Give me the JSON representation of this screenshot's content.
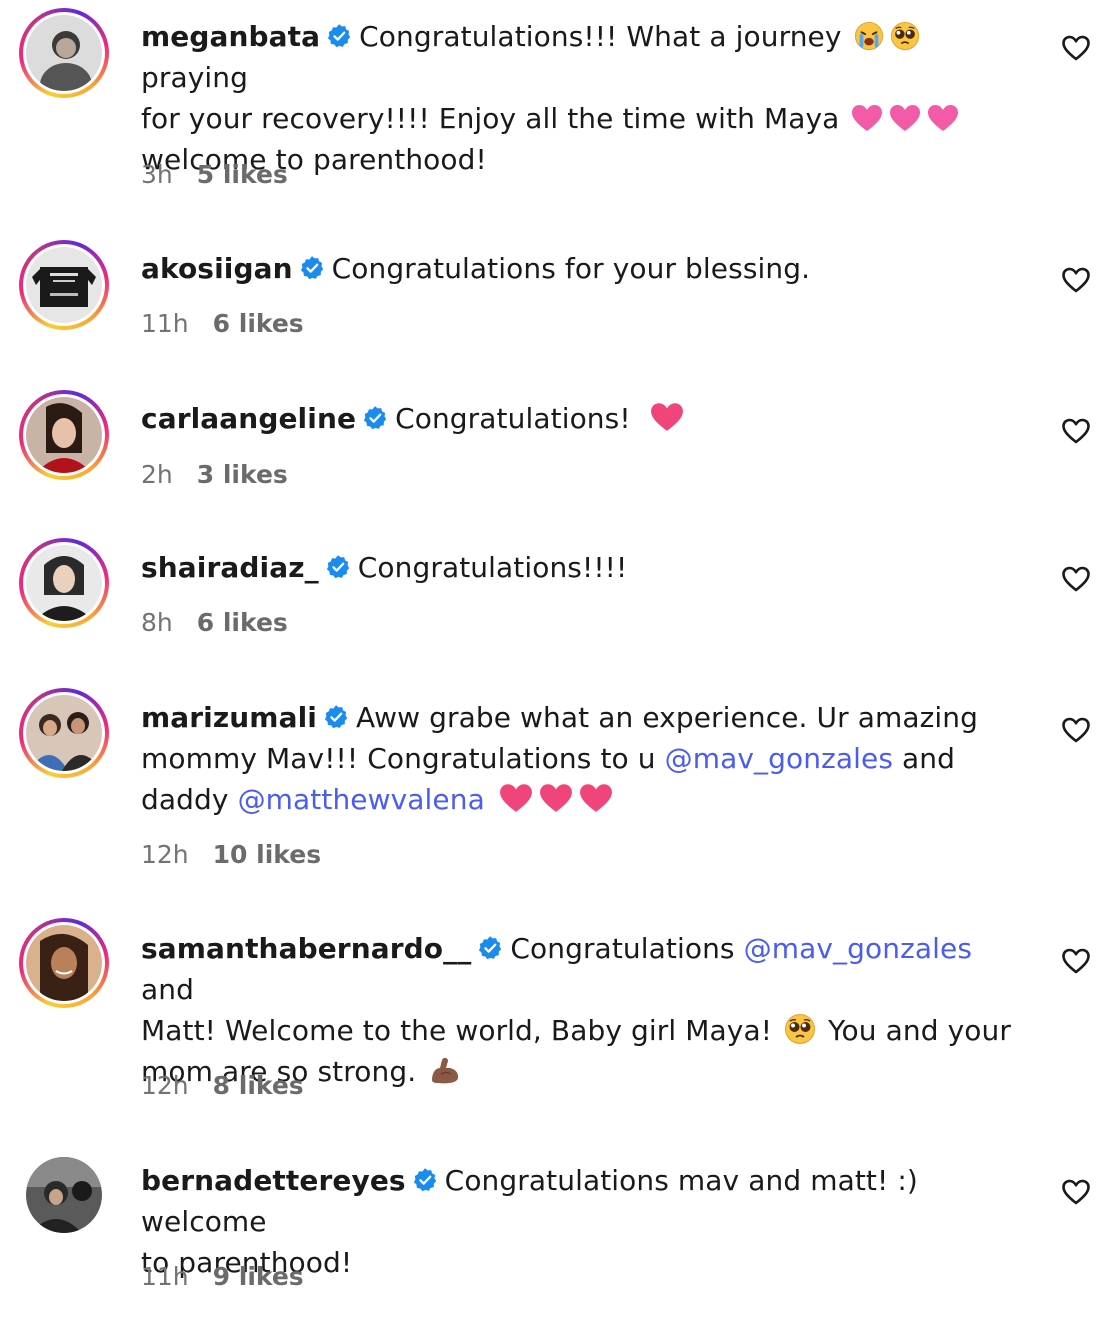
{
  "colors": {
    "mention": "#4a5df0",
    "verified": "#1a8cf0",
    "meta_text": "#737373",
    "heart_emoji": "#f0457a"
  },
  "comments": [
    {
      "username": "meganbata",
      "verified": true,
      "text_parts": [
        "Congratulations!!! What a journey ",
        " praying",
        "for your recovery!!!! Enjoy all the time with Maya ",
        "welcome to parenthood!"
      ],
      "emojis": [
        "crying-face-emoji",
        "pleading-face-emoji",
        "pink-heart-emoji",
        "pink-heart-emoji",
        "pink-heart-emoji"
      ],
      "time": "3h",
      "likes": "5 likes"
    },
    {
      "username": "akosiigan",
      "verified": true,
      "text_parts": [
        "Congratulations for your blessing."
      ],
      "time": "11h",
      "likes": "6 likes"
    },
    {
      "username": "carlaangeline",
      "verified": true,
      "text_parts": [
        "Congratulations! "
      ],
      "emojis": [
        "red-heart-emoji"
      ],
      "time": "2h",
      "likes": "3 likes"
    },
    {
      "username": "shairadiaz_",
      "verified": true,
      "text_parts": [
        "Congratulations!!!!"
      ],
      "time": "8h",
      "likes": "6 likes"
    },
    {
      "username": "marizumali",
      "verified": true,
      "text_parts": [
        "Aww grabe what an experience. Ur amazing",
        "mommy Mav!!! Congratulations to u ",
        "@mav_gonzales",
        " and",
        "daddy ",
        "@matthewvalena"
      ],
      "emojis": [
        "red-heart-emoji",
        "red-heart-emoji",
        "red-heart-emoji"
      ],
      "time": "12h",
      "likes": "10 likes"
    },
    {
      "username": "samanthabernardo__",
      "verified": true,
      "text_parts": [
        "Congratulations ",
        "@mav_gonzales",
        " and",
        "Matt! Welcome to the world, Baby girl Maya! ",
        " You and your",
        "mom are so strong. "
      ],
      "emojis": [
        "pleading-face-emoji",
        "flexed-biceps-emoji"
      ],
      "time": "12h",
      "likes": "8 likes"
    },
    {
      "username": "bernadettereyes",
      "verified": true,
      "text_parts": [
        "Congratulations mav and matt! :) welcome",
        "to parenthood!"
      ],
      "time": "11h",
      "likes": "9 likes"
    }
  ]
}
